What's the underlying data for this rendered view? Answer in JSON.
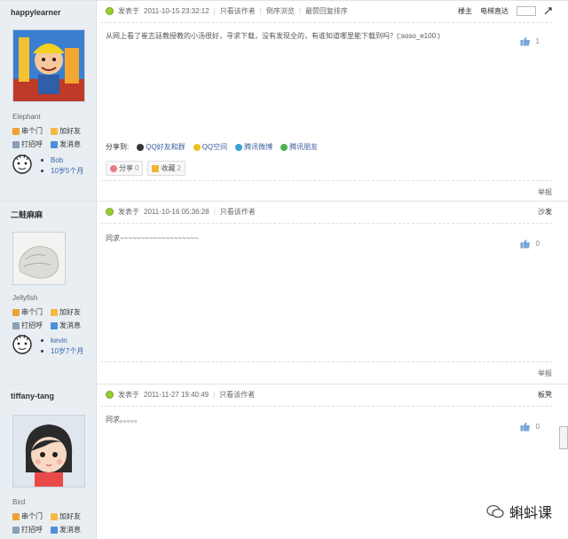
{
  "posts": [
    {
      "username": "happylearner",
      "group": "Elephant",
      "actions": [
        "串个门",
        "加好友",
        "打招呼",
        "发消息"
      ],
      "medals": [
        "Bob",
        "10岁5个月"
      ],
      "posted_prefix": "发表于",
      "datetime": "2011-10-15 23:32:12",
      "only_author": "只看该作者",
      "extra_links": [
        "倒序浏览",
        "最赞回复排序"
      ],
      "floor_links": [
        "楼主",
        "电梯直达"
      ],
      "content": "从网上看了崔志廷教授教的小汤很好，寻求下载，没有发现全的，有谁知道哪里能下载到吗？(:soso_e100:)",
      "likes": "1",
      "share_label": "分享到:",
      "share_targets": [
        "QQ好友和群",
        "QQ空间",
        "腾讯微博",
        "腾讯朋友"
      ],
      "share_btn": "分享",
      "share_count": "0",
      "fav_btn": "收藏",
      "fav_count": "2",
      "report": "举报"
    },
    {
      "username": "二鲑麻麻",
      "group": "Jellyfish",
      "actions": [
        "串个门",
        "加好友",
        "打招呼",
        "发消息"
      ],
      "medals": [
        "kevin",
        "10岁7个月"
      ],
      "posted_prefix": "发表于",
      "datetime": "2011-10-16 05:36:28",
      "only_author": "只看该作者",
      "floor": "沙发",
      "content": "同求~~~~~~~~~~~~~~~~~~~",
      "likes": "0",
      "report": "举报"
    },
    {
      "username": "tiffany-tang",
      "group": "Bird",
      "actions": [
        "串个门",
        "加好友",
        "打招呼",
        "发消息"
      ],
      "posted_prefix": "发表于",
      "datetime": "2011-11-27 19:40:49",
      "only_author": "只看该作者",
      "floor": "板凳",
      "content": "同求。。。。。",
      "likes": "0"
    }
  ],
  "watermark": "蝌蚪课",
  "colors": {
    "sidebar": "#e9eef3",
    "link": "#3a5f9a",
    "online": "#9acd32"
  }
}
